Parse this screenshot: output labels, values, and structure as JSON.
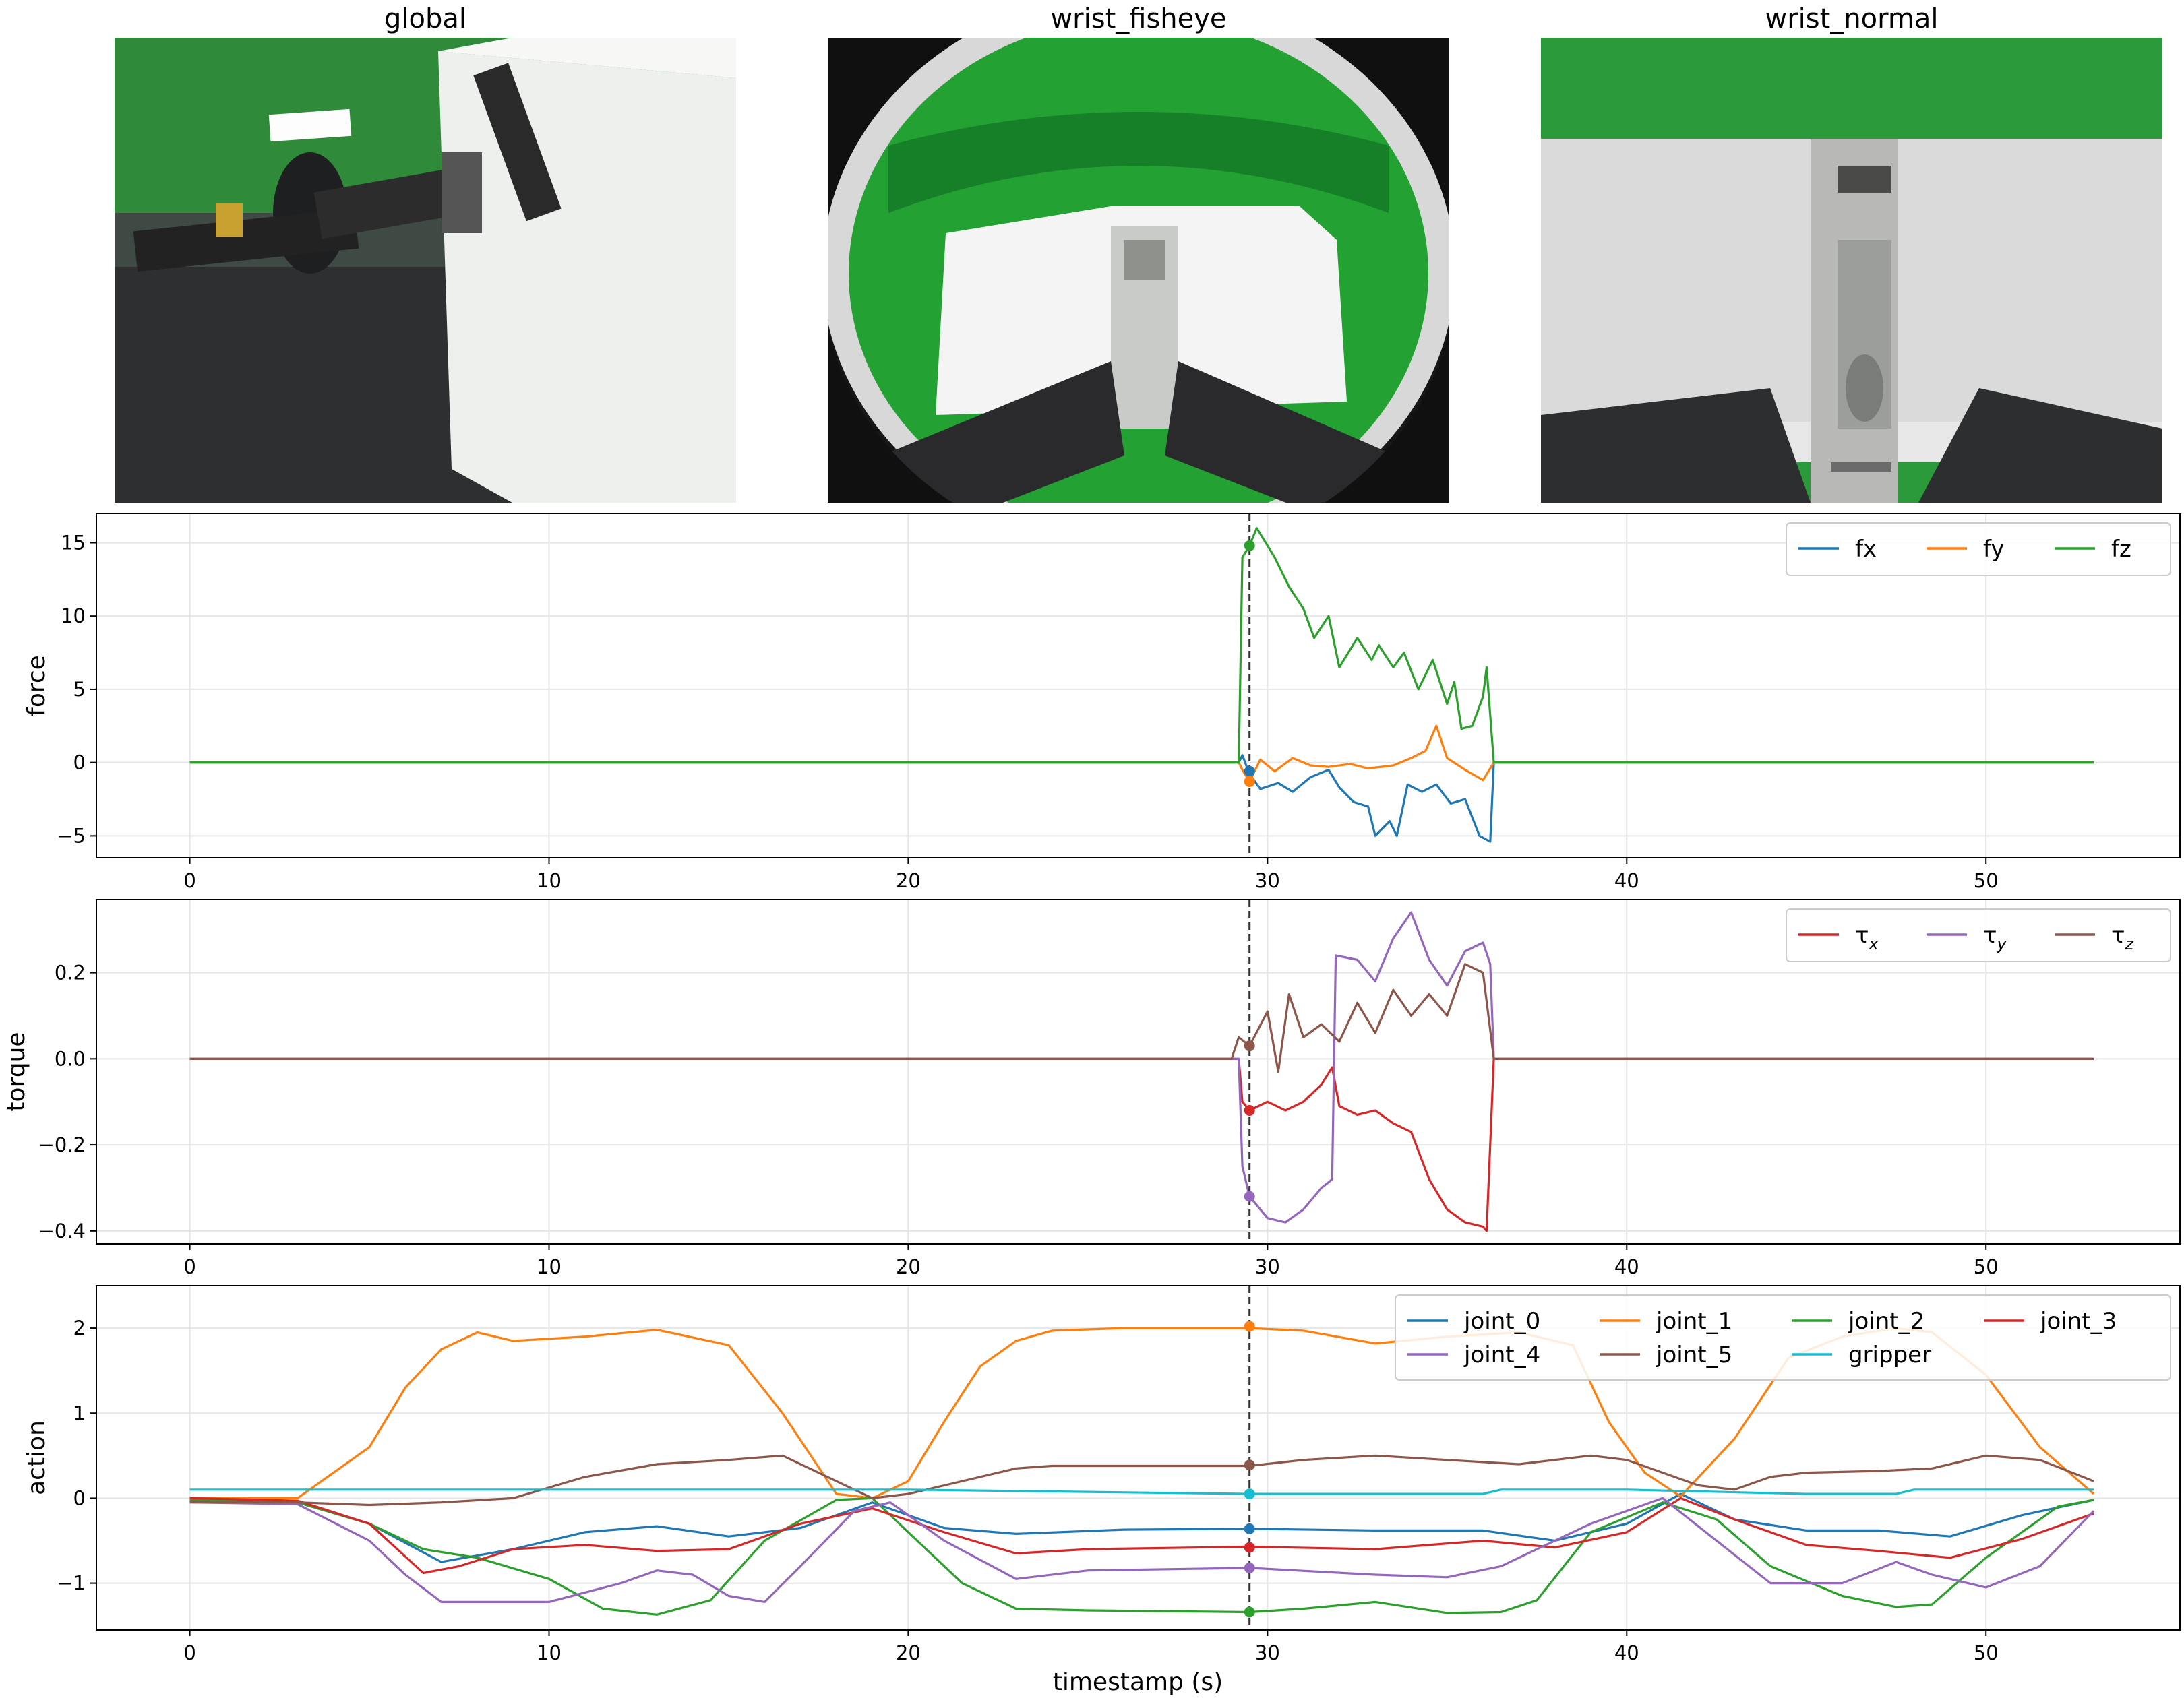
{
  "images": [
    {
      "title": "global"
    },
    {
      "title": "wrist_fisheye"
    },
    {
      "title": "wrist_normal"
    }
  ],
  "xlabel": "timestamp (s)",
  "cursor_time": 29.5,
  "chart_data": [
    {
      "type": "line",
      "ylabel": "force",
      "xlim": [
        -2.6,
        55.4
      ],
      "ylim": [
        -6.5,
        17.0
      ],
      "xticks": [
        0,
        10,
        20,
        30,
        40,
        50
      ],
      "yticks": [
        -5,
        0,
        5,
        10,
        15
      ],
      "grid": true,
      "legend": "top-right",
      "series": [
        {
          "name": "fx",
          "color": "#1f77b4",
          "x": [
            0,
            29.2,
            29.3,
            29.5,
            29.8,
            30.3,
            30.7,
            31.2,
            31.7,
            32.0,
            32.4,
            32.8,
            33.0,
            33.4,
            33.6,
            33.9,
            34.3,
            34.7,
            35.1,
            35.5,
            35.9,
            36.2,
            36.3,
            53
          ],
          "y": [
            0,
            0,
            0.5,
            -0.8,
            -1.8,
            -1.4,
            -2.0,
            -1.0,
            -0.5,
            -1.7,
            -2.7,
            -3.0,
            -5.0,
            -4.0,
            -5.0,
            -1.5,
            -2.0,
            -1.5,
            -2.8,
            -2.5,
            -5.0,
            -5.4,
            0,
            0
          ]
        },
        {
          "name": "fy",
          "color": "#ff7f0e",
          "x": [
            0,
            29.2,
            29.3,
            29.5,
            29.8,
            30.2,
            30.7,
            31.2,
            31.7,
            32.3,
            32.8,
            33.5,
            34.0,
            34.4,
            34.7,
            35.0,
            35.5,
            36.0,
            36.3,
            53
          ],
          "y": [
            0,
            0,
            -0.5,
            -1.3,
            0.2,
            -0.6,
            0.3,
            -0.2,
            -0.3,
            -0.1,
            -0.4,
            -0.2,
            0.3,
            0.8,
            2.5,
            0.3,
            -0.5,
            -1.2,
            0,
            0
          ]
        },
        {
          "name": "fz",
          "color": "#2ca02c",
          "x": [
            0,
            29.2,
            29.3,
            29.5,
            29.7,
            30.2,
            30.6,
            31.0,
            31.3,
            31.7,
            32.0,
            32.5,
            32.9,
            33.1,
            33.5,
            33.8,
            34.2,
            34.6,
            35.0,
            35.2,
            35.4,
            35.7,
            36.0,
            36.1,
            36.3,
            53
          ],
          "y": [
            0,
            0,
            14.0,
            14.8,
            16.0,
            14.0,
            12.0,
            10.5,
            8.5,
            10.0,
            6.5,
            8.5,
            7.0,
            8.0,
            6.5,
            7.5,
            5.0,
            7.0,
            4.0,
            5.5,
            2.3,
            2.5,
            4.5,
            6.5,
            0,
            0
          ]
        }
      ],
      "markers": {
        "x": 29.5,
        "y": [
          -0.6,
          -1.3,
          14.8
        ]
      }
    },
    {
      "type": "line",
      "ylabel": "torque",
      "xlim": [
        -2.6,
        55.4
      ],
      "ylim": [
        -0.43,
        0.37
      ],
      "xticks": [
        0,
        10,
        20,
        30,
        40,
        50
      ],
      "yticks": [
        -0.4,
        -0.2,
        0.0,
        0.2
      ],
      "grid": true,
      "legend": "top-right",
      "series": [
        {
          "name": "τx",
          "color": "#d62728",
          "x": [
            0,
            29.2,
            29.3,
            29.5,
            30.0,
            30.5,
            31.0,
            31.5,
            31.8,
            32.0,
            32.5,
            33.0,
            33.5,
            34.0,
            34.5,
            35.0,
            35.5,
            36.0,
            36.1,
            36.3,
            53
          ],
          "y": [
            0,
            0,
            -0.1,
            -0.12,
            -0.1,
            -0.12,
            -0.1,
            -0.06,
            -0.02,
            -0.11,
            -0.13,
            -0.12,
            -0.15,
            -0.17,
            -0.28,
            -0.35,
            -0.38,
            -0.39,
            -0.4,
            0,
            0
          ]
        },
        {
          "name": "τy",
          "color": "#9467bd",
          "x": [
            0,
            29.2,
            29.3,
            29.5,
            30.0,
            30.5,
            31.0,
            31.5,
            31.8,
            31.9,
            32.5,
            33.0,
            33.5,
            34.0,
            34.5,
            35.0,
            35.5,
            36.0,
            36.2,
            36.3,
            53
          ],
          "y": [
            0,
            0,
            -0.25,
            -0.32,
            -0.37,
            -0.38,
            -0.35,
            -0.3,
            -0.28,
            0.24,
            0.23,
            0.18,
            0.28,
            0.34,
            0.23,
            0.17,
            0.25,
            0.27,
            0.22,
            0,
            0
          ]
        },
        {
          "name": "τz",
          "color": "#8c564b",
          "x": [
            0,
            29.0,
            29.2,
            29.5,
            30.0,
            30.3,
            30.6,
            31.0,
            31.5,
            32.0,
            32.5,
            33.0,
            33.5,
            34.0,
            34.5,
            35.0,
            35.5,
            36.0,
            36.3,
            53
          ],
          "y": [
            0,
            0,
            0.05,
            0.03,
            0.11,
            -0.03,
            0.15,
            0.05,
            0.08,
            0.04,
            0.13,
            0.06,
            0.16,
            0.1,
            0.15,
            0.1,
            0.22,
            0.2,
            0,
            0
          ]
        }
      ],
      "markers": {
        "x": 29.5,
        "y": [
          -0.12,
          -0.32,
          0.03
        ]
      }
    },
    {
      "type": "line",
      "ylabel": "action",
      "xlim": [
        -2.6,
        55.4
      ],
      "ylim": [
        -1.55,
        2.5
      ],
      "xticks": [
        0,
        10,
        20,
        30,
        40,
        50
      ],
      "yticks": [
        -1,
        0,
        1,
        2
      ],
      "grid": true,
      "legend": "top-right",
      "series": [
        {
          "name": "joint_0",
          "color": "#1f77b4",
          "x": [
            0,
            3,
            5,
            7,
            9,
            11,
            13,
            15,
            17,
            19,
            21,
            23,
            26,
            29.5,
            33,
            36,
            38,
            40,
            41.5,
            43,
            45,
            47,
            49,
            51,
            53
          ],
          "y": [
            -0.03,
            -0.05,
            -0.3,
            -0.75,
            -0.6,
            -0.4,
            -0.33,
            -0.45,
            -0.35,
            -0.05,
            -0.35,
            -0.42,
            -0.37,
            -0.36,
            -0.38,
            -0.38,
            -0.5,
            -0.3,
            0.05,
            -0.25,
            -0.38,
            -0.38,
            -0.45,
            -0.2,
            -0.02
          ]
        },
        {
          "name": "joint_1",
          "color": "#ff7f0e",
          "x": [
            0,
            3,
            4,
            5,
            6,
            7,
            8,
            9,
            11,
            13,
            15,
            16.5,
            18,
            19,
            20,
            21,
            22,
            23,
            24,
            26,
            29.5,
            31,
            33,
            35,
            37,
            38.5,
            39.5,
            40.5,
            41.5,
            43,
            44.5,
            46,
            47.5,
            48.5,
            50,
            51.5,
            53
          ],
          "y": [
            0,
            0,
            0.3,
            0.6,
            1.3,
            1.75,
            1.95,
            1.85,
            1.9,
            1.98,
            1.8,
            1.0,
            0.05,
            0.0,
            0.2,
            0.9,
            1.55,
            1.85,
            1.97,
            2.0,
            2.0,
            1.97,
            1.82,
            1.9,
            1.95,
            1.8,
            0.9,
            0.3,
            0.02,
            0.7,
            1.65,
            1.9,
            2.0,
            1.95,
            1.45,
            0.6,
            0.05
          ]
        },
        {
          "name": "joint_2",
          "color": "#2ca02c",
          "x": [
            0,
            3,
            5,
            6.5,
            8,
            10,
            11.5,
            13,
            14.5,
            16,
            18,
            19,
            20,
            21.5,
            23,
            25,
            29.5,
            31,
            33,
            35,
            36.5,
            37.5,
            39,
            41,
            42.5,
            44,
            46,
            47.5,
            48.5,
            50,
            52,
            53
          ],
          "y": [
            -0.02,
            -0.05,
            -0.3,
            -0.6,
            -0.7,
            -0.95,
            -1.3,
            -1.37,
            -1.2,
            -0.5,
            -0.02,
            0.0,
            -0.4,
            -1.0,
            -1.3,
            -1.32,
            -1.34,
            -1.3,
            -1.22,
            -1.35,
            -1.34,
            -1.2,
            -0.4,
            -0.05,
            -0.25,
            -0.8,
            -1.15,
            -1.28,
            -1.25,
            -0.7,
            -0.1,
            -0.02
          ]
        },
        {
          "name": "joint_3",
          "color": "#d62728",
          "x": [
            0,
            3,
            5,
            6.5,
            7.5,
            9,
            11,
            13,
            15,
            17,
            19,
            21,
            23,
            25,
            29.5,
            33,
            36,
            38,
            40,
            41.5,
            43,
            45,
            47,
            49,
            51,
            53
          ],
          "y": [
            0,
            -0.03,
            -0.3,
            -0.88,
            -0.8,
            -0.6,
            -0.55,
            -0.62,
            -0.6,
            -0.3,
            -0.12,
            -0.4,
            -0.65,
            -0.6,
            -0.57,
            -0.6,
            -0.5,
            -0.58,
            -0.4,
            0.0,
            -0.25,
            -0.55,
            -0.62,
            -0.7,
            -0.48,
            -0.18
          ]
        },
        {
          "name": "joint_4",
          "color": "#9467bd",
          "x": [
            0,
            3,
            5,
            6,
            7,
            8,
            10,
            12,
            13,
            14,
            15,
            16,
            17,
            18.5,
            19.5,
            21,
            23,
            25,
            29.5,
            33,
            35,
            36.5,
            37.5,
            39,
            41,
            42.5,
            44,
            46,
            47.5,
            48.5,
            50,
            51.5,
            53
          ],
          "y": [
            -0.05,
            -0.07,
            -0.5,
            -0.9,
            -1.22,
            -1.22,
            -1.22,
            -1.0,
            -0.85,
            -0.9,
            -1.15,
            -1.22,
            -0.8,
            -0.15,
            -0.05,
            -0.5,
            -0.95,
            -0.85,
            -0.82,
            -0.9,
            -0.93,
            -0.8,
            -0.6,
            -0.3,
            0.0,
            -0.5,
            -1.0,
            -1.0,
            -0.75,
            -0.9,
            -1.05,
            -0.8,
            -0.15
          ]
        },
        {
          "name": "joint_5",
          "color": "#8c564b",
          "x": [
            0,
            3,
            5,
            7,
            9,
            11,
            13,
            15,
            16.5,
            18,
            19,
            20,
            21,
            23,
            24,
            26,
            29.5,
            31,
            33,
            35,
            37,
            39,
            40,
            41,
            42,
            43,
            44,
            45,
            47,
            48.5,
            50,
            51.5,
            53
          ],
          "y": [
            -0.05,
            -0.05,
            -0.08,
            -0.05,
            0.0,
            0.25,
            0.4,
            0.45,
            0.5,
            0.2,
            0.0,
            0.05,
            0.15,
            0.35,
            0.38,
            0.38,
            0.38,
            0.45,
            0.5,
            0.45,
            0.4,
            0.5,
            0.45,
            0.3,
            0.15,
            0.1,
            0.25,
            0.3,
            0.32,
            0.35,
            0.5,
            0.45,
            0.2
          ]
        },
        {
          "name": "gripper",
          "color": "#17becf",
          "x": [
            0,
            10,
            20,
            29.5,
            36,
            36.5,
            40,
            45,
            47.5,
            48,
            53
          ],
          "y": [
            0.1,
            0.1,
            0.1,
            0.05,
            0.05,
            0.1,
            0.1,
            0.05,
            0.05,
            0.1,
            0.1
          ]
        }
      ],
      "markers": {
        "x": 29.5,
        "y": [
          -0.36,
          2.02,
          -1.34,
          -0.58,
          -0.82,
          0.39,
          0.05
        ]
      }
    }
  ]
}
